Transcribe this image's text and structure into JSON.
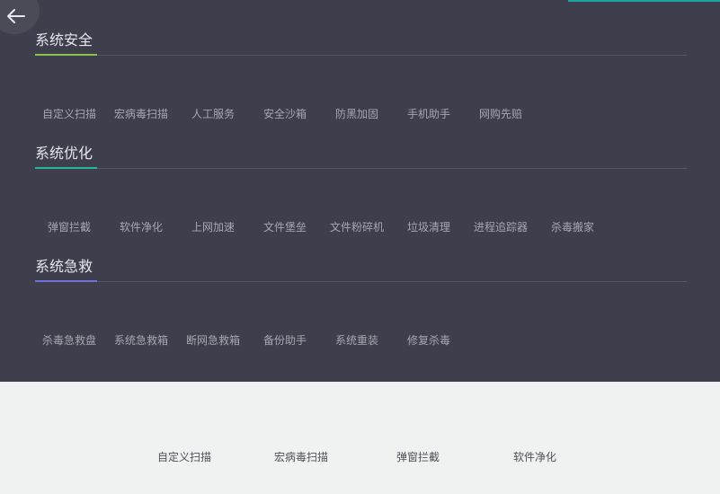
{
  "colors": {
    "panel": "#3e3e4c",
    "bottom": "#f0f2f1",
    "accent_top": "#1aa3a3"
  },
  "back_icon": "arrow-left-icon",
  "sections": [
    {
      "title": "系统安全",
      "underline_color": "#8bc34a",
      "items": [
        "自定义扫描",
        "宏病毒扫描",
        "人工服务",
        "安全沙箱",
        "防黑加固",
        "手机助手",
        "网购先赔"
      ]
    },
    {
      "title": "系统优化",
      "underline_color": "#26b5a0",
      "items": [
        "弹窗拦截",
        "软件净化",
        "上网加速",
        "文件堡垒",
        "文件粉碎机",
        "垃圾清理",
        "进程追踪器",
        "杀毒搬家"
      ]
    },
    {
      "title": "系统急救",
      "underline_color": "#6f72d6",
      "items": [
        "杀毒急救盘",
        "系统急救箱",
        "断网急救箱",
        "备份助手",
        "系统重装",
        "修复杀毒"
      ]
    }
  ],
  "bottom_items": [
    "自定义扫描",
    "宏病毒扫描",
    "弹窗拦截",
    "软件净化"
  ]
}
